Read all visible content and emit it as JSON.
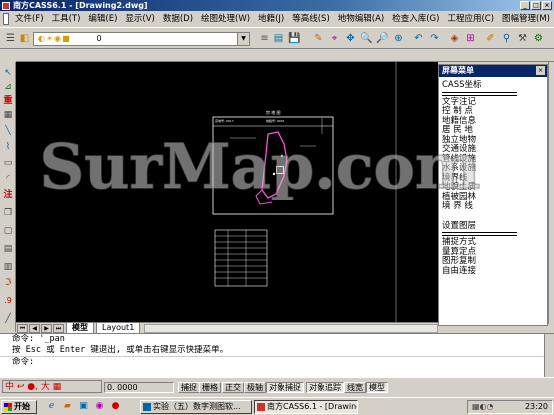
{
  "window": {
    "title": "南方CASS6.1 - [Drawing2.dwg]",
    "controls": {
      "minimize": "_",
      "restore": "□",
      "close": "×"
    }
  },
  "menubar": {
    "items": [
      "文件(F)",
      "工具(T)",
      "编辑(E)",
      "显示(V)",
      "数据(D)",
      "绘图处理(W)",
      "地籍(J)",
      "等高线(S)",
      "地物编辑(A)",
      "检查入库(G)",
      "工程应用(C)",
      "图幅管理(M)"
    ]
  },
  "toolbar": {
    "layer_value": "0"
  },
  "tabs": {
    "items": [
      "模型",
      "Layout1"
    ]
  },
  "screen_menu": {
    "title": "屏幕菜单",
    "close": "×",
    "items_top": [
      "CASS坐标"
    ],
    "items_mid": [
      "文字注记",
      "控 制 点",
      "地籍信息",
      "居 民 地",
      "独立地物",
      "交通设施",
      "管线设施",
      "水系设施",
      "境界线",
      "地貌土质",
      "植被园林",
      "境 界 线"
    ],
    "items_bottom": [
      "设置图层"
    ],
    "items_tail": [
      "捕捉方式",
      "量算定点",
      "图形复制",
      "自由连接"
    ]
  },
  "command": {
    "line1": "命令: '_pan",
    "line2": "按 Esc 或 Enter 键退出, 或单击右键显示快捷菜单。",
    "line3": "命令:"
  },
  "statusbar": {
    "ime": "中 ↩ ●, 大 ▦",
    "coords": "0. 0000",
    "buttons": [
      "捕捉",
      "栅格",
      "正交",
      "极轴",
      "对象捕捉",
      "对象追踪",
      "线宽",
      "模型"
    ]
  },
  "taskbar": {
    "start": "开始",
    "tasks": [
      "实验（五）数字测图软...",
      "南方CASS6.1 - [Drawing..."
    ],
    "clock": "23:20"
  },
  "watermark": "SurMap.com",
  "drawing": {
    "frame_title": "宗 地 图",
    "header_left": "宗地号: 0017",
    "header_right": "地籍号: 0001"
  },
  "colors": {
    "title_start": "#0a246a",
    "title_end": "#a6caf0",
    "canvas": "#000000"
  }
}
